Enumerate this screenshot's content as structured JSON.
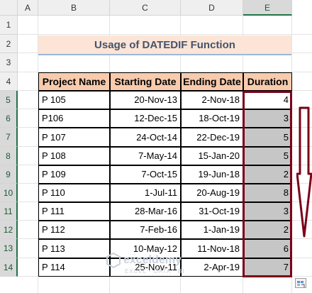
{
  "sheet": {
    "columns": [
      "A",
      "B",
      "C",
      "D",
      "E"
    ],
    "rows": [
      "1",
      "2",
      "3",
      "4",
      "5",
      "6",
      "7",
      "8",
      "9",
      "10",
      "11",
      "12",
      "13",
      "14"
    ],
    "selected_column": "E"
  },
  "title": "Usage of DATEDIF Function",
  "table": {
    "headers": [
      "Project Name",
      "Starting Date",
      "Ending Date",
      "Duration"
    ],
    "rows": [
      [
        "P 105",
        "20-Nov-13",
        "2-Nov-18",
        "4"
      ],
      [
        "P106",
        "12-Dec-15",
        "18-Oct-19",
        "3"
      ],
      [
        "P 107",
        "24-Oct-14",
        "22-Dec-19",
        "5"
      ],
      [
        "P 108",
        "7-May-14",
        "15-Jan-20",
        "5"
      ],
      [
        "P 109",
        "7-Oct-15",
        "19-Jun-18",
        "2"
      ],
      [
        "P 110",
        "1-Jul-11",
        "20-Aug-19",
        "8"
      ],
      [
        "P 111",
        "28-Mar-16",
        "31-Oct-19",
        "3"
      ],
      [
        "P 112",
        "7-Feb-16",
        "1-Jan-19",
        "2"
      ],
      [
        "P 113",
        "10-May-12",
        "11-Nov-18",
        "6"
      ],
      [
        "P 114",
        "25-Nov-11",
        "2-Apr-19",
        "7"
      ]
    ]
  },
  "watermark": {
    "name": "exceldemy",
    "tagline": "EXCEL · DATA · BI"
  },
  "colors": {
    "selection": "#7b0019",
    "header_fill": "#f8cbad",
    "title_fill": "#fce4d6",
    "fill_gray": "#c6c6c6"
  },
  "icons": [
    "down-arrow-icon",
    "quick-analysis-icon",
    "watermark-logo-icon"
  ]
}
